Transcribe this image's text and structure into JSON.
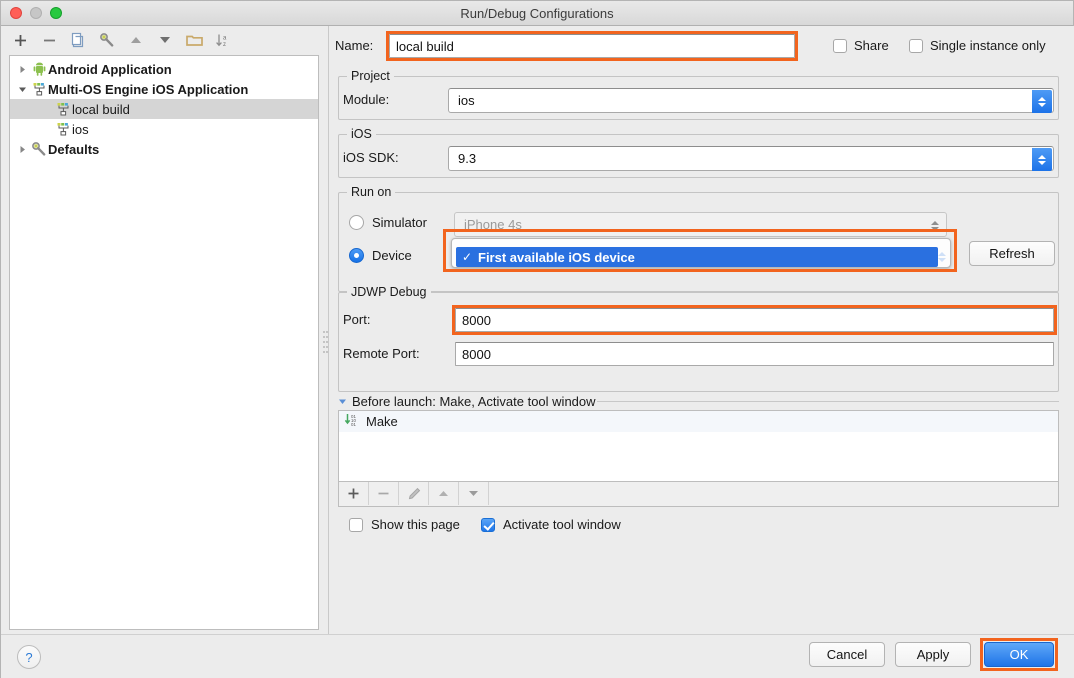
{
  "window": {
    "title": "Run/Debug Configurations",
    "accent_orange": "#F2641E",
    "accent_blue": "#2A70E0"
  },
  "toolbar": {
    "items": [
      {
        "icon": "plus-icon",
        "label": "+"
      },
      {
        "icon": "minus-icon",
        "label": "−"
      },
      {
        "icon": "copy-icon",
        "label": "copy"
      },
      {
        "icon": "wrench-icon",
        "label": "edit-defaults"
      },
      {
        "icon": "arrow-up-icon",
        "label": "move-up"
      },
      {
        "icon": "arrow-down-icon",
        "label": "move-down"
      },
      {
        "icon": "folder-icon",
        "label": "folder"
      },
      {
        "icon": "sort-alpha-icon",
        "label": "sort"
      }
    ]
  },
  "tree": {
    "nodes": [
      {
        "label": "Android Application",
        "icon": "android-icon",
        "bold": true,
        "twisty": "collapsed",
        "indent": 0,
        "selected": false
      },
      {
        "label": "Multi-OS Engine iOS Application",
        "icon": "moe-icon",
        "bold": true,
        "twisty": "expanded",
        "indent": 0,
        "selected": false
      },
      {
        "label": "local build",
        "icon": "moe-icon",
        "bold": false,
        "twisty": "none",
        "indent": 1,
        "selected": true
      },
      {
        "label": "ios",
        "icon": "moe-icon",
        "bold": false,
        "twisty": "none",
        "indent": 1,
        "selected": false
      },
      {
        "label": "Defaults",
        "icon": "wrench-icon",
        "bold": true,
        "twisty": "collapsed",
        "indent": 0,
        "selected": false
      }
    ]
  },
  "form": {
    "name_label": "Name:",
    "name_value": "local build",
    "share_label": "Share",
    "share_checked": false,
    "single_instance_label": "Single instance only",
    "single_instance_checked": false,
    "project_group": "Project",
    "module_label": "Module:",
    "module_value": "ios",
    "ios_group": "iOS",
    "ios_sdk_label": "iOS SDK:",
    "ios_sdk_value": "9.3",
    "run_on_group": "Run on",
    "simulator_label": "Simulator",
    "simulator_selected": false,
    "simulator_value": "iPhone 4s",
    "device_label": "Device",
    "device_selected": true,
    "device_value": "First available iOS device",
    "device_dropdown_open": true,
    "device_dropdown_check": "✓",
    "refresh_label": "Refresh",
    "jdwp_group": "JDWP Debug",
    "port_label": "Port:",
    "port_value": "8000",
    "remote_port_label": "Remote Port:",
    "remote_port_value": "8000"
  },
  "before_launch": {
    "header": "Before launch: Make, Activate tool window",
    "twisty": "expanded",
    "items": [
      {
        "label": "Make",
        "icon": "make-icon"
      }
    ],
    "toolbar": [
      {
        "icon": "plus-icon",
        "label": "+"
      },
      {
        "icon": "minus-icon",
        "label": "−"
      },
      {
        "icon": "pencil-icon",
        "label": "edit"
      },
      {
        "icon": "arrow-up-icon",
        "label": "up"
      },
      {
        "icon": "arrow-down-icon",
        "label": "down"
      }
    ],
    "show_page_label": "Show this page",
    "show_page_checked": false,
    "activate_tool_window_label": "Activate tool window",
    "activate_tool_window_checked": true
  },
  "footer": {
    "help_label": "?",
    "cancel_label": "Cancel",
    "apply_label": "Apply",
    "ok_label": "OK"
  }
}
